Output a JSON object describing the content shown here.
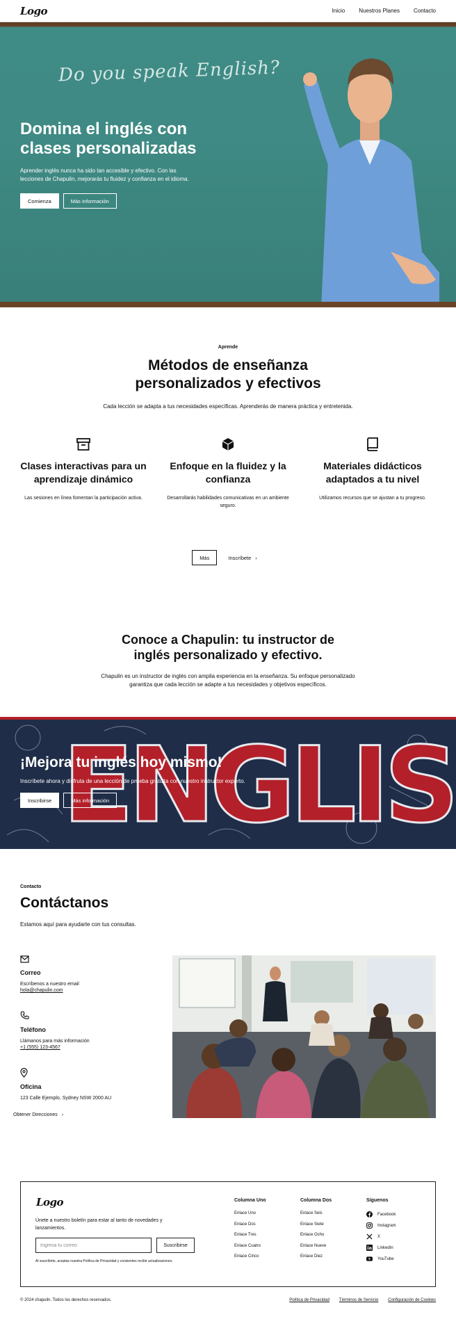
{
  "nav": {
    "logo": "Logo",
    "links": [
      "Inicio",
      "Nuestros Planes",
      "Contacto"
    ]
  },
  "hero": {
    "chalk_text": "Do you speak English?",
    "title": "Domina el inglés con clases personalizadas",
    "text": "Aprender inglés nunca ha sido tan accesible y efectivo. Con las lecciones de Chapulin, mejorarás tu fluidez y confianza en el idioma.",
    "primary_button": "Comienza",
    "secondary_button": "Más información"
  },
  "methods": {
    "eyebrow": "Aprende",
    "title": "Métodos de enseñanza personalizados y efectivos",
    "text": "Cada lección se adapta a tus necesidades específicas. Aprenderás de manera práctica y entretenida.",
    "features": [
      {
        "icon": "archive-box-icon",
        "title": "Clases interactivas para un aprendizaje dinámico",
        "text": "Las sesiones en línea fomentan la participación activa."
      },
      {
        "icon": "cube-icon",
        "title": "Enfoque en la fluidez y la confianza",
        "text": "Desarrollarás habilidades comunicativas en un ambiente seguro."
      },
      {
        "icon": "book-icon",
        "title": "Materiales didácticos adaptados a tu nivel",
        "text": "Utilizamos recursos que se ajustan a tu progreso."
      }
    ],
    "more_button": "Más",
    "signup_link": "Inscríbete"
  },
  "about": {
    "title": "Conoce a Chapulin: tu instructor de inglés personalizado y efectivo.",
    "text": "Chapulin es un instructor de inglés con amplia experiencia en la enseñanza. Su enfoque personalizado garantiza que cada lección se adapte a tus necesidades y objetivos específicos."
  },
  "cta": {
    "background_word": "ENGLISH",
    "title": "¡Mejora tu inglés hoy mismo!",
    "text": "Inscríbete ahora y disfruta de una lección de prueba gratuita con nuestro instructor experto.",
    "primary_button": "Inscribirse",
    "secondary_button": "Más información"
  },
  "contact": {
    "eyebrow": "Contacto",
    "title": "Contáctanos",
    "subtitle": "Estamos aquí para ayudarte con tus consultas.",
    "email": {
      "title": "Correo",
      "text": "Escríbenos a nuestro email",
      "link": "hola@chapulin.com"
    },
    "phone": {
      "title": "Teléfono",
      "text": "Llámanos para más información",
      "link": "+1 (555) 123-4567"
    },
    "office": {
      "title": "Oficina",
      "text": "123 Calle Ejemplo, Sydney NSW 2000 AU"
    },
    "directions": "Obtener Direcciones"
  },
  "footer": {
    "logo": "Logo",
    "newsletter_text": "Únete a nuestro boletín para estar al tanto de novedades y lanzamientos.",
    "email_placeholder": "Ingresa tu correo",
    "subscribe_button": "Suscribirse",
    "legal_note": "Al suscribirte, aceptas nuestra Política de Privacidad y consientes recibir actualizaciones.",
    "column_one": {
      "title": "Columna Uno",
      "items": [
        "Enlace Uno",
        "Enlace Dos",
        "Enlace Tres",
        "Enlace Cuatro",
        "Enlace Cinco"
      ]
    },
    "column_two": {
      "title": "Columna Dos",
      "items": [
        "Enlace Seis",
        "Enlace Siete",
        "Enlace Ocho",
        "Enlace Nueve",
        "Enlace Diez"
      ]
    },
    "social": {
      "title": "Síguenos",
      "items": [
        "Facebook",
        "Instagram",
        "X",
        "LinkedIn",
        "YouTube"
      ]
    },
    "copyright": "© 2024 chapulin. Todos los derechos reservados.",
    "bottom_links": [
      "Política de Privacidad",
      "Términos de Servicio",
      "Configuración de Cookies"
    ]
  },
  "colors": {
    "chalkboard": "#3f8a84",
    "cta_navy": "#1f2d48",
    "cta_red": "#b3202a",
    "shirt_blue": "#6f9fd8"
  }
}
